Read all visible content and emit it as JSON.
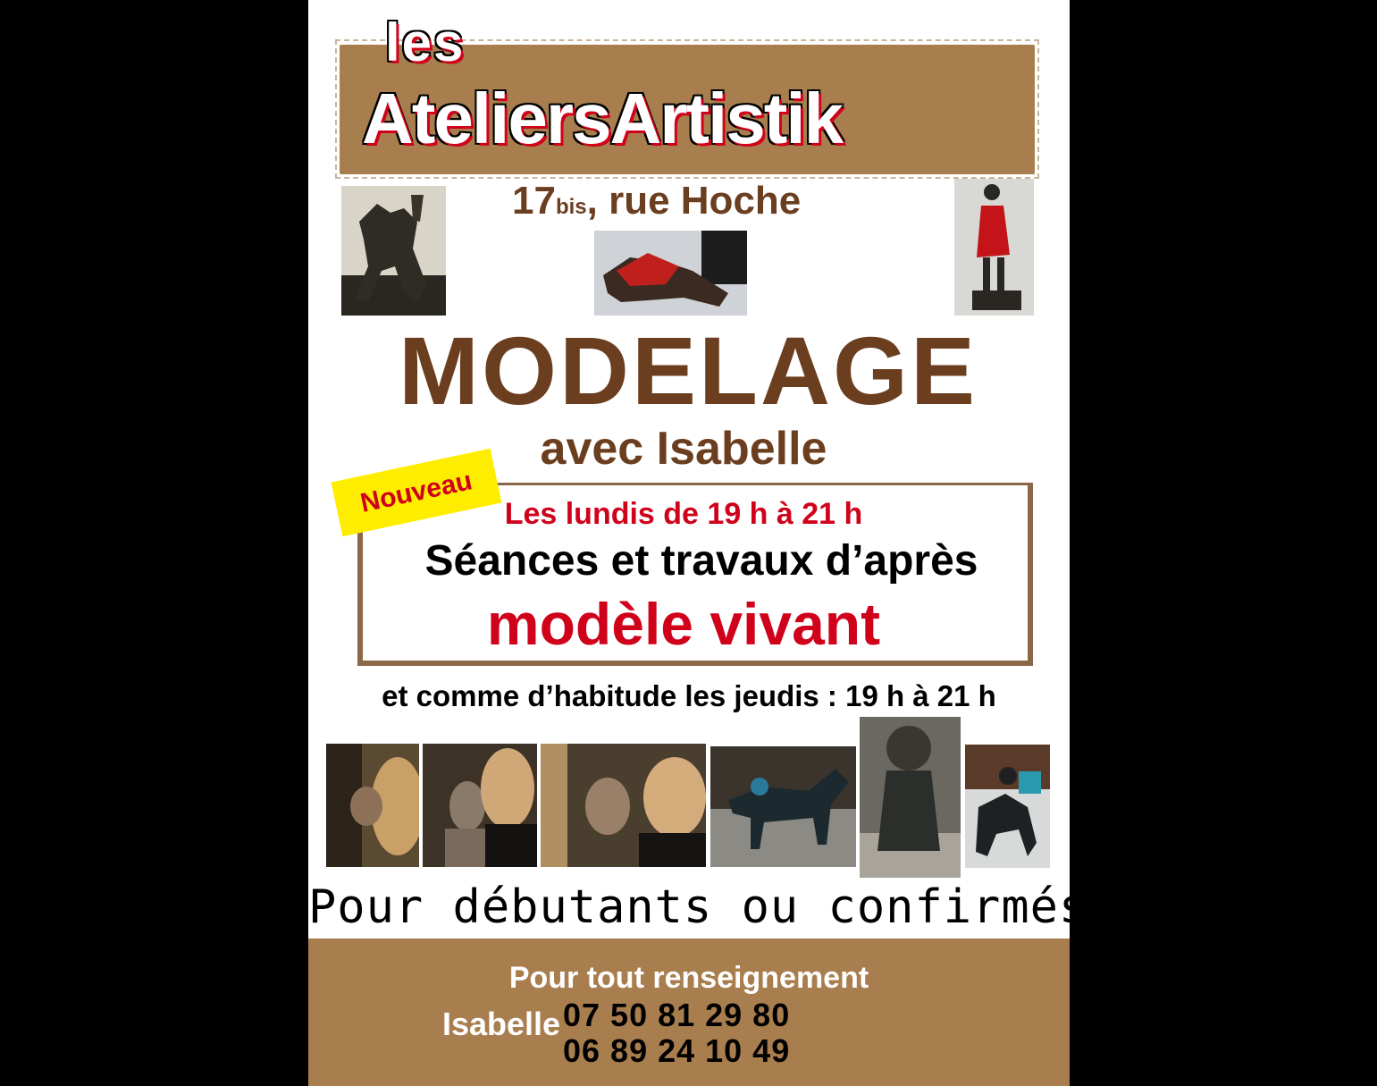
{
  "header": {
    "line1": "les",
    "brand": "AteliersArtistik"
  },
  "address": {
    "number": "17",
    "suffix": "bis",
    "street": ", rue Hoche"
  },
  "title": "MODELAGE",
  "subtitle": "avec Isabelle",
  "badge": "Nouveau",
  "schedule": {
    "mondays": "Les lundis de 19 h à 21 h",
    "sessions": "Séances et travaux d’après",
    "model": "modèle vivant",
    "thursdays": "et comme d’habitude les jeudis : 19 h à 21 h"
  },
  "level": "Pour débutants ou confirmés",
  "footer": {
    "info": "Pour tout renseignement",
    "name": "Isabelle",
    "phone1": "07 50 81 29 80",
    "phone2": "06 89 24 10 49"
  },
  "colors": {
    "background": "#000000",
    "poster": "#ffffff",
    "brown": "#6b3e1f",
    "banner": "#a97e4e",
    "red": "#d0021b",
    "yellow": "#ffed00"
  },
  "images": [
    "horse-rider-sculpture-photo",
    "reclining-figure-sculpture-photo",
    "standing-woman-red-dress-sculpture-photo",
    "sculptor-working-photo-1",
    "sculptor-working-photo-2",
    "sculptor-working-photo-3",
    "horse-sculpture-photo",
    "seated-figure-sculpture-photo",
    "centaur-sculpture-photo"
  ]
}
